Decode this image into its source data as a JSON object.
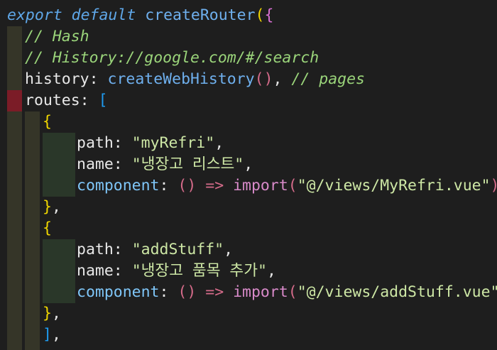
{
  "code": {
    "line1": {
      "export": "export",
      "default": "default",
      "fn": "createRouter",
      "paren": "(",
      "brace": "{"
    },
    "line2": {
      "comment": "// Hash"
    },
    "line3": {
      "comment": "// History://google.com/#/search"
    },
    "line4": {
      "key": "history",
      "colon": ":",
      "call": "createWebHistory",
      "parens": "()",
      "comma": ",",
      "comment": "// pages"
    },
    "line5": {
      "key": "routes",
      "colon": ":",
      "bracket": "["
    },
    "line6": {
      "brace": "{"
    },
    "line7": {
      "key": "path",
      "colon": ":",
      "value": "\"myRefri\"",
      "comma": ","
    },
    "line8": {
      "key": "name",
      "colon": ":",
      "value": "\"냉장고 리스트\"",
      "comma": ","
    },
    "line9": {
      "key": "component",
      "colon": ":",
      "parens": "()",
      "arrow": "=>",
      "import": "import",
      "open": "(",
      "value": "\"@/views/MyRefri.vue\"",
      "close": ")",
      "comma": ","
    },
    "line10": {
      "brace": "}",
      "comma": ","
    },
    "line11": {
      "brace": "{"
    },
    "line12": {
      "key": "path",
      "colon": ":",
      "value": "\"addStuff\"",
      "comma": ","
    },
    "line13": {
      "key": "name",
      "colon": ":",
      "value": "\"냉장고 품목 추가\"",
      "comma": ","
    },
    "line14": {
      "key": "component",
      "colon": ":",
      "parens": "()",
      "arrow": "=>",
      "import": "import",
      "open": "(",
      "value": "\"@/views/addStuff.vue\"",
      "close": ")",
      "comma": ","
    },
    "line15": {
      "brace": "}",
      "comma": ","
    },
    "line16": {
      "bracket": "]",
      "comma": ","
    }
  },
  "colors": {
    "background": "#1e1e1e",
    "keyword": "#5fa7e8",
    "function": "#dcdcaa",
    "string": "#cde7a5",
    "comment": "#9ad47a",
    "bracket_level1": "#f1d700",
    "bracket_level2": "#d86fd3",
    "bracket_level3": "#1e9bf0",
    "error_highlight": "#7b1c27"
  }
}
